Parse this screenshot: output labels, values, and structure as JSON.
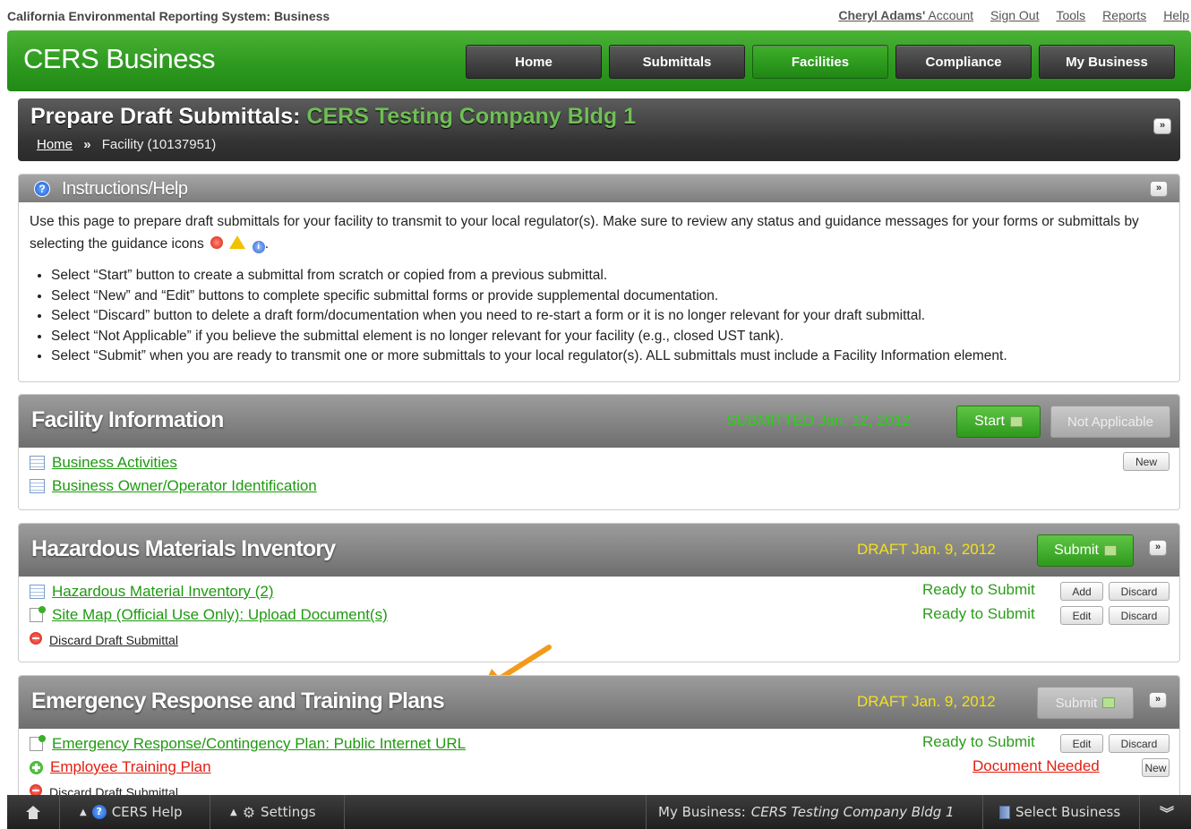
{
  "top": {
    "site_title": "California Environmental Reporting System: Business",
    "account_name": "Cheryl Adams'",
    "account_suffix": " Account",
    "sign_out": "Sign Out",
    "tools": "Tools",
    "reports": "Reports",
    "help": "Help"
  },
  "header": {
    "brand": "CERS Business",
    "nav": [
      "Home",
      "Submittals",
      "Facilities",
      "Compliance",
      "My Business"
    ],
    "active_nav": "Facilities"
  },
  "page": {
    "title_prefix": "Prepare Draft Submittals:",
    "title_facility": "CERS Testing Company Bldg 1",
    "breadcrumb_home": "Home",
    "breadcrumb_sep": "»",
    "breadcrumb_current": "Facility (10137951)"
  },
  "instructions": {
    "title": "Instructions/Help",
    "intro": "Use this page to prepare draft submittals for your facility to transmit to your local regulator(s). Make sure to review any status and guidance messages for your forms or submittals by selecting the guidance icons",
    "intro_end": ".",
    "bullets": [
      "Select “Start” button to create a submittal from scratch or copied from a previous submittal.",
      "Select “New” and “Edit” buttons to complete specific submittal forms or provide supplemental documentation.",
      "Select “Discard” button to delete a draft form/documentation when you need to re-start a form or it is no longer relevant for your draft submittal.",
      "Select “Not Applicable” if you believe the submittal element is no longer relevant for your facility (e.g., closed UST tank).",
      "Select “Submit” when you are ready to transmit one or more submittals to your local regulator(s). ALL submittals must include a Facility Information element."
    ]
  },
  "sections": {
    "facility": {
      "title": "Facility Information",
      "status": "SUBMITTED Jan. 12, 2012",
      "start_btn": "Start",
      "na_btn": "Not Applicable",
      "items": [
        "Business Activities",
        "Business Owner/Operator Identification"
      ],
      "new_btn": "New"
    },
    "hmi": {
      "title": "Hazardous Materials Inventory",
      "status": "DRAFT Jan. 9, 2012",
      "submit_btn": "Submit",
      "items": [
        {
          "label": "Hazardous Material Inventory (2)",
          "status": "Ready to Submit",
          "btn1": "Add",
          "btn2": "Discard"
        },
        {
          "label": "Site Map (Official Use Only): Upload Document(s)",
          "status": "Ready to Submit",
          "btn1": "Edit",
          "btn2": "Discard"
        }
      ],
      "discard_draft": "Discard Draft Submittal"
    },
    "ertp": {
      "title": "Emergency Response and Training Plans",
      "status": "DRAFT Jan. 9, 2012",
      "submit_btn": "Submit",
      "items": [
        {
          "label": "Emergency Response/Contingency Plan: Public Internet URL",
          "status": "Ready to Submit",
          "btn1": "Edit",
          "btn2": "Discard"
        },
        {
          "label": "Employee Training Plan",
          "status": "Document Needed",
          "btn1": "New"
        }
      ],
      "discard_draft": "Discard Draft Submittal"
    }
  },
  "bottom": {
    "help": "CERS Help",
    "settings": "Settings",
    "my_business_label": "My Business:",
    "my_business_name": "CERS Testing Company Bldg 1",
    "select_business": "Select Business"
  },
  "colors": {
    "brand_green": "#2e9a1f",
    "submitted_green": "#2ccf1a",
    "draft_yellow": "#f3e01c",
    "needed_red": "#e31d10",
    "arrow_orange": "#f39a1a"
  }
}
